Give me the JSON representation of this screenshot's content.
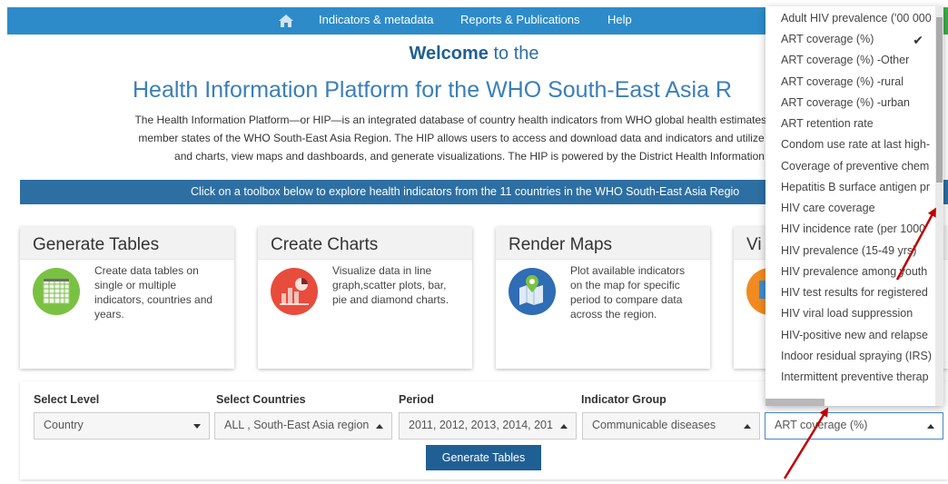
{
  "nav": {
    "items": [
      "Indicators & metadata",
      "Reports & Publications",
      "Help"
    ]
  },
  "welcome": {
    "bold": "Welcome",
    "rest": " to the"
  },
  "platform_title": "Health Information Platform for the WHO South-East Asia R",
  "intro": {
    "line1": "The Health Information Platform—or HIP—is an integrated database of country health indicators from WHO global health estimates and nation",
    "line2": "member states of the WHO South-East Asia Region. The HIP allows users to access and download data and indicators and utilize interactive",
    "line3": "and charts, view maps and dashboards, and generate visualizations. The HIP is powered by the District Health Information So"
  },
  "banner": "Click on a toolbox below to explore health indicators from the 11 countries in the WHO South-East Asia Regio",
  "cards": [
    {
      "title": "Generate Tables",
      "desc": "Create data tables on single or multiple indicators, countries and years."
    },
    {
      "title": "Create Charts",
      "desc": "Visualize data in line graph,scatter plots, bar, pie and diamond charts."
    },
    {
      "title": "Render Maps",
      "desc": "Plot available indicators on the map for specific period to compare data across the region."
    },
    {
      "title": "Vi",
      "desc": ""
    }
  ],
  "filters": {
    "labels": [
      "Select Level",
      "Select Countries",
      "Period",
      "Indicator Group"
    ],
    "values": {
      "level": "Country",
      "countries": "ALL , South-East Asia region",
      "period": "2011, 2012, 2013, 2014, 201",
      "group": "Communicable diseases",
      "indicator": "ART coverage (%)"
    },
    "button": "Generate Tables"
  },
  "dropdown": {
    "items": [
      "Adult HIV prevalence ('00 000",
      "ART coverage (%)",
      "ART coverage (%) -Other",
      "ART coverage (%) -rural",
      "ART coverage (%) -urban",
      "ART retention rate",
      "Condom use rate at last high-",
      "Coverage of preventive chem",
      "Hepatitis B surface antigen pr",
      "HIV care coverage",
      "HIV incidence rate (per 1000",
      "HIV prevalence (15-49 yrs)",
      "HIV prevalence among youth",
      "HIV test results for registered",
      "HIV viral load suppression",
      "HIV-positive new and relapse",
      "Indoor residual spraying (IRS)",
      "Intermittent preventive therap"
    ],
    "selected_index": 1
  },
  "colors": {
    "nav_bar": "#2d8bc9",
    "banner": "#2d6fa3",
    "title_blue": "#3a7fb8",
    "button": "#1f5f94",
    "annotation_arrow": "#c00000"
  }
}
